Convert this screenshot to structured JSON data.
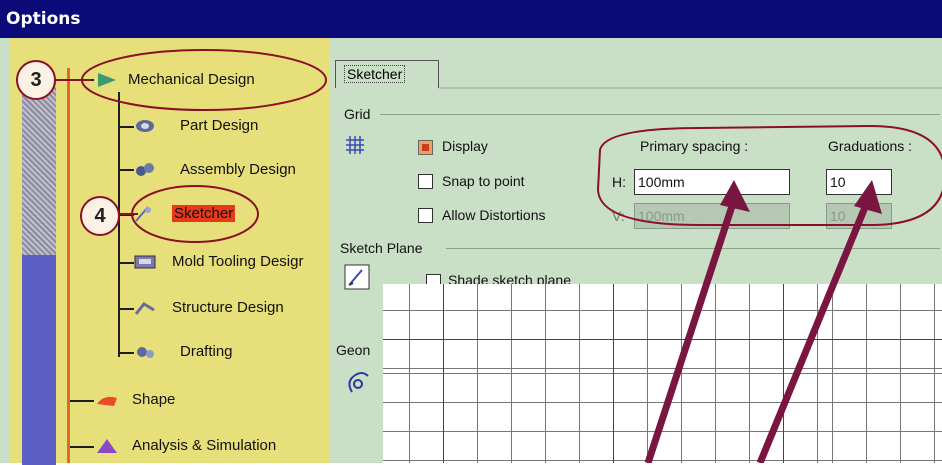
{
  "window": {
    "title": "Options"
  },
  "tree": {
    "items": [
      {
        "label": "Mechanical Design",
        "icon": "mechanical-design-icon"
      },
      {
        "label": "Part Design",
        "icon": "part-design-icon"
      },
      {
        "label": "Assembly Design",
        "icon": "assembly-design-icon"
      },
      {
        "label": "Sketcher",
        "icon": "sketcher-icon",
        "selected": true
      },
      {
        "label": "Mold Tooling Desigr",
        "icon": "mold-tooling-icon"
      },
      {
        "label": "Structure Design",
        "icon": "structure-design-icon"
      },
      {
        "label": "Drafting",
        "icon": "drafting-icon"
      },
      {
        "label": "Shape",
        "icon": "shape-icon"
      },
      {
        "label": "Analysis & Simulation",
        "icon": "analysis-simulation-icon"
      }
    ]
  },
  "tabs": [
    {
      "label": "Sketcher",
      "active": true
    }
  ],
  "grid": {
    "group_label": "Grid",
    "display_label": "Display",
    "display_checked": true,
    "snap_label": "Snap to point",
    "allow_distortions_label": "Allow Distortions",
    "primary_spacing_label": "Primary spacing :",
    "graduations_label": "Graduations :",
    "h_label": "H:",
    "v_label": "V:",
    "h_spacing_value": "100mm",
    "h_graduations_value": "10",
    "v_spacing_value": "100mm",
    "v_graduations_value": "10"
  },
  "sketch_plane": {
    "group_label": "Sketch Plane",
    "shade_label": "Shade sketch plane"
  },
  "geometry": {
    "group_label": "Geon"
  },
  "callouts": [
    {
      "number": "3"
    },
    {
      "number": "4"
    }
  ],
  "colors": {
    "titlebar": "#0a0b78",
    "tree_background": "#e7df7a",
    "panel_background": "#c9dfc6",
    "annotation": "#8a1028",
    "selected_highlight": "#e83a1a"
  }
}
